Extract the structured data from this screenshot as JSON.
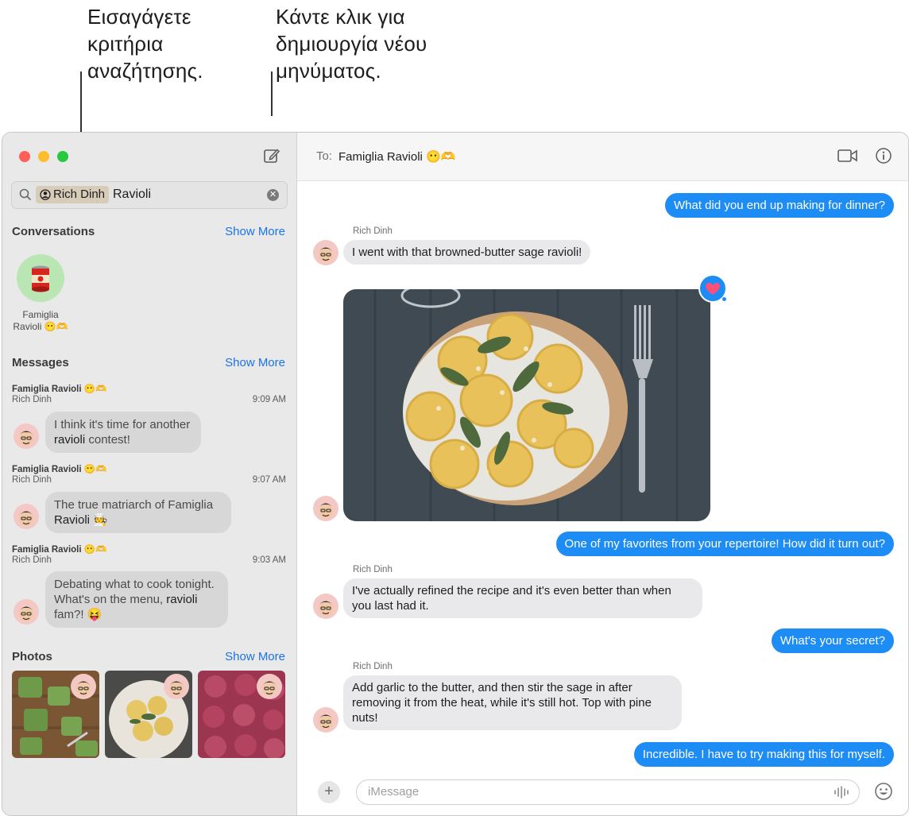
{
  "callouts": {
    "search_lines": [
      "Εισαγάγετε",
      "κριτήρια",
      "αναζήτησης."
    ],
    "compose_lines": [
      "Κάντε κλικ για",
      "δημιουργία νέου",
      "μηνύματος."
    ]
  },
  "sidebar": {
    "search": {
      "token": "Rich Dinh",
      "text": "Ravioli"
    },
    "conversations": {
      "title": "Conversations",
      "show_more": "Show More",
      "item": {
        "name_line1": "Famiglia",
        "name_line2": "Ravioli 😶🫶"
      }
    },
    "messages": {
      "title": "Messages",
      "show_more": "Show More",
      "items": [
        {
          "group": "Famiglia Ravioli 😶🫶",
          "sender": "Rich Dinh",
          "time": "9:09 AM",
          "text_pre": "I think it's time for another ",
          "text_match": "ravioli",
          "text_post": " contest!"
        },
        {
          "group": "Famiglia Ravioli 😶🫶",
          "sender": "Rich Dinh",
          "time": "9:07 AM",
          "text_pre": "The true matriarch of Famiglia ",
          "text_match": "Ravioli",
          "text_post": " 🧑‍🍳"
        },
        {
          "group": "Famiglia Ravioli 😶🫶",
          "sender": "Rich Dinh",
          "time": "9:03 AM",
          "text_pre": "Debating what to cook tonight. What's on the menu, ",
          "text_match": "ravioli",
          "text_post": " fam?! 😝"
        }
      ]
    },
    "photos": {
      "title": "Photos",
      "show_more": "Show More"
    }
  },
  "chat": {
    "to_label": "To:",
    "to_name": "Famiglia Ravioli 😶🫶",
    "messages": [
      {
        "dir": "out",
        "text": "What did you end up making for dinner?"
      },
      {
        "dir": "in",
        "sender": "Rich Dinh",
        "text": "I went with that browned-butter sage ravioli!"
      },
      {
        "dir": "out",
        "text": "One of my favorites from your repertoire! How did it turn out?"
      },
      {
        "dir": "in",
        "sender": "Rich Dinh",
        "text": "I've actually refined the recipe and it's even better than when you last had it."
      },
      {
        "dir": "out",
        "text": "What's your secret?"
      },
      {
        "dir": "in",
        "sender": "Rich Dinh",
        "text": "Add garlic to the butter, and then stir the sage in after removing it from the heat, while it's still hot. Top with pine nuts!"
      },
      {
        "dir": "out",
        "text": "Incredible. I have to try making this for myself."
      }
    ],
    "input_placeholder": "iMessage"
  },
  "colors": {
    "accent": "#1e8cf5",
    "link": "#1a73e8",
    "close": "#ff5f57",
    "minimize": "#febc2e",
    "zoom": "#28c840"
  }
}
